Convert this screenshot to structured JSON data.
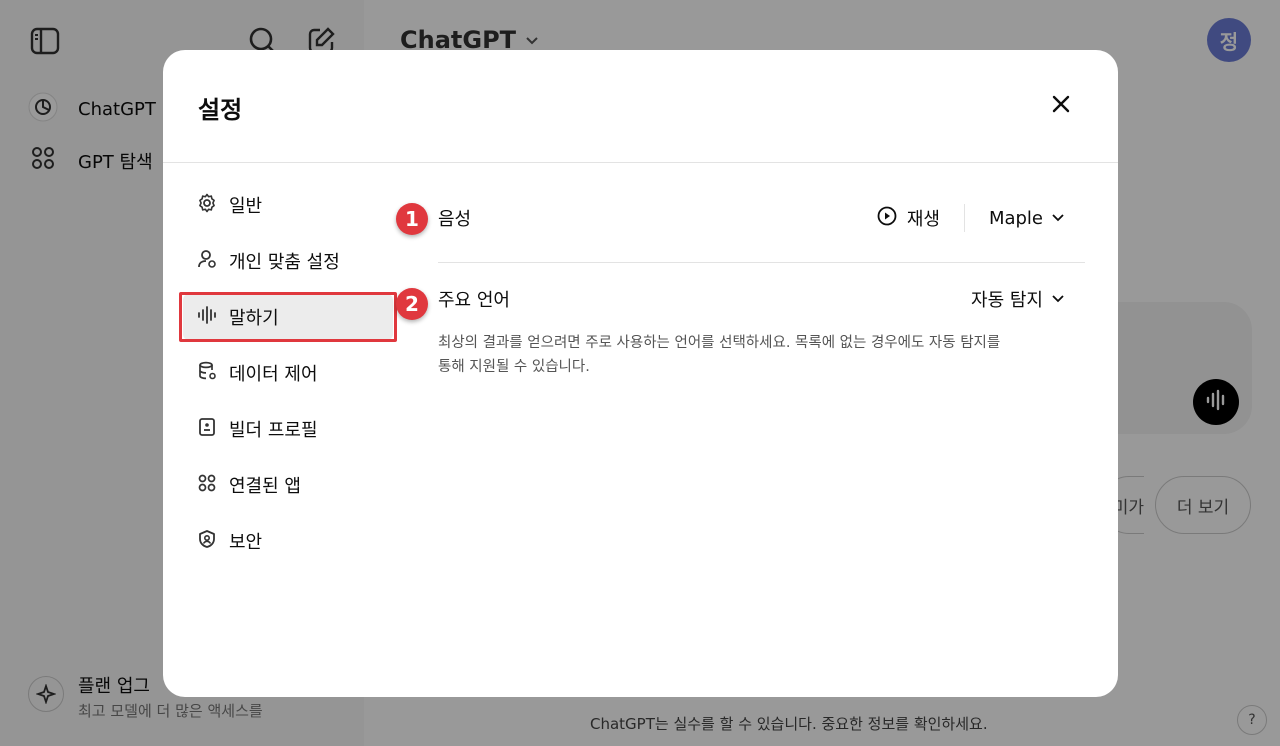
{
  "app": {
    "title": "ChatGPT",
    "sidebar_items": [
      {
        "label": "ChatGPT",
        "icon": "openai-icon"
      },
      {
        "label": "GPT 탐색",
        "icon": "grid-icon"
      }
    ],
    "upgrade": {
      "title": "플랜 업그",
      "subtitle": "최고 모델에 더 많은 액세스를"
    },
    "avatar": "정",
    "suggestions": [
      "미가",
      "더 보기"
    ],
    "footer_note": "ChatGPT는 실수를 할 수 있습니다. 중요한 정보를 확인하세요.",
    "help": "?"
  },
  "modal": {
    "title": "설정",
    "nav": [
      {
        "label": "일반",
        "icon": "gear-icon"
      },
      {
        "label": "개인 맞춤 설정",
        "icon": "person-icon"
      },
      {
        "label": "말하기",
        "icon": "waveform-icon",
        "active": true
      },
      {
        "label": "데이터 제어",
        "icon": "database-icon"
      },
      {
        "label": "빌더 프로필",
        "icon": "id-card-icon"
      },
      {
        "label": "연결된 앱",
        "icon": "apps-icon"
      },
      {
        "label": "보안",
        "icon": "shield-icon"
      }
    ],
    "voice": {
      "label": "음성",
      "play": "재생",
      "value": "Maple"
    },
    "language": {
      "label": "주요 언어",
      "value": "자동 탐지",
      "description": "최상의 결과를 얻으려면 주로 사용하는 언어를 선택하세요. 목록에 없는 경우에도 자동 탐지를 통해 지원될 수 있습니다."
    }
  },
  "annotations": [
    "1",
    "2"
  ],
  "colors": {
    "annotation": "#e0383e",
    "avatar": "#6b7cd6"
  }
}
